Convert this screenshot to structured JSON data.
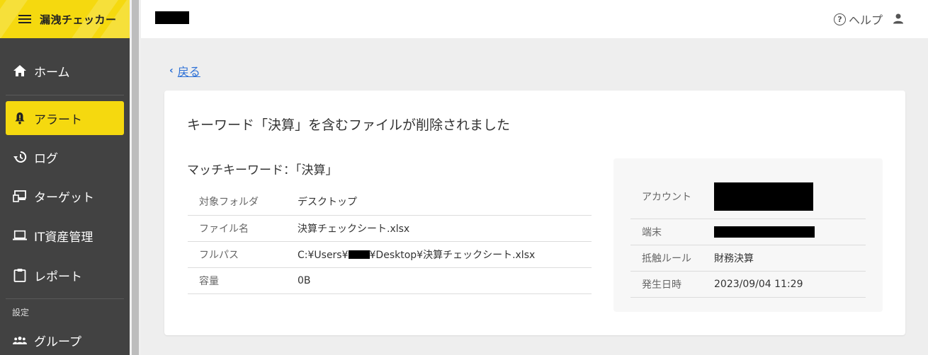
{
  "app": {
    "title": "漏洩チェッカー"
  },
  "nav": {
    "items": [
      {
        "label": "ホーム",
        "icon": "home-icon"
      },
      {
        "label": "アラート",
        "icon": "bell-icon",
        "active": true
      },
      {
        "label": "ログ",
        "icon": "history-icon"
      },
      {
        "label": "ターゲット",
        "icon": "target-device-icon"
      },
      {
        "label": "IT資産管理",
        "icon": "laptop-icon"
      },
      {
        "label": "レポート",
        "icon": "clipboard-icon"
      }
    ],
    "section_label": "設定",
    "settings_items": [
      {
        "label": "グループ",
        "icon": "group-icon"
      }
    ]
  },
  "header": {
    "help_label": "ヘルプ",
    "help_icon_glyph": "?"
  },
  "main": {
    "back_label": "戻る",
    "back_glyph": "‹",
    "card_title": "キーワード「決算」を含むファイルが削除されました",
    "match_title": "マッチキーワード：「決算」",
    "details": [
      {
        "key": "対象フォルダ",
        "value": "デスクトップ"
      },
      {
        "key": "ファイル名",
        "value": "決算チェックシート.xlsx"
      },
      {
        "key": "フルパス",
        "value_prefix": "C:¥Users¥",
        "value_suffix": "¥Desktop¥決算チェックシート.xlsx"
      },
      {
        "key": "容量",
        "value": "0B"
      }
    ],
    "side": [
      {
        "key": "アカウント"
      },
      {
        "key": "端末"
      },
      {
        "key": "抵触ルール",
        "value": "財務決算"
      },
      {
        "key": "発生日時",
        "value": "2023/09/04 11:29"
      }
    ]
  },
  "colors": {
    "accent": "#f5d90f",
    "sidebar": "#424242",
    "link": "#2a6fd6"
  }
}
